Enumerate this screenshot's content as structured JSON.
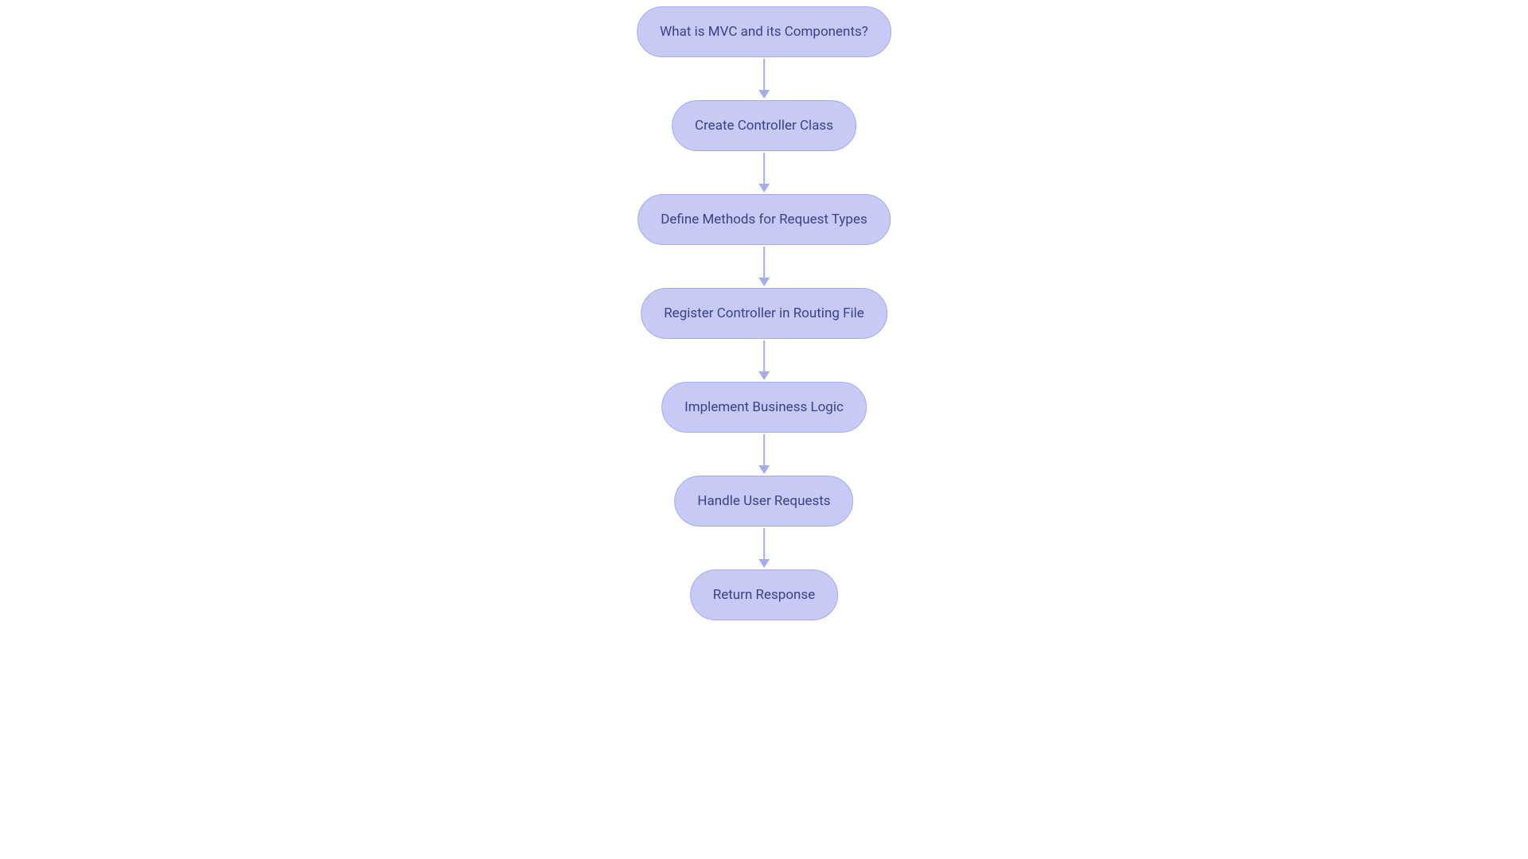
{
  "diagram": {
    "type": "flowchart-vertical",
    "nodeStyle": {
      "fill": "#c6caf4",
      "stroke": "#a5acee",
      "textColor": "#3d3f8a",
      "shape": "stadium"
    },
    "arrowColor": "#a5acee",
    "nodes": [
      {
        "id": "n0",
        "label": "What is MVC and its Components?"
      },
      {
        "id": "n1",
        "label": "Create Controller Class"
      },
      {
        "id": "n2",
        "label": "Define Methods for Request Types"
      },
      {
        "id": "n3",
        "label": "Register Controller in Routing File"
      },
      {
        "id": "n4",
        "label": "Implement Business Logic"
      },
      {
        "id": "n5",
        "label": "Handle User Requests"
      },
      {
        "id": "n6",
        "label": "Return Response"
      }
    ],
    "edges": [
      {
        "from": "n0",
        "to": "n1"
      },
      {
        "from": "n1",
        "to": "n2"
      },
      {
        "from": "n2",
        "to": "n3"
      },
      {
        "from": "n3",
        "to": "n4"
      },
      {
        "from": "n4",
        "to": "n5"
      },
      {
        "from": "n5",
        "to": "n6"
      }
    ]
  }
}
